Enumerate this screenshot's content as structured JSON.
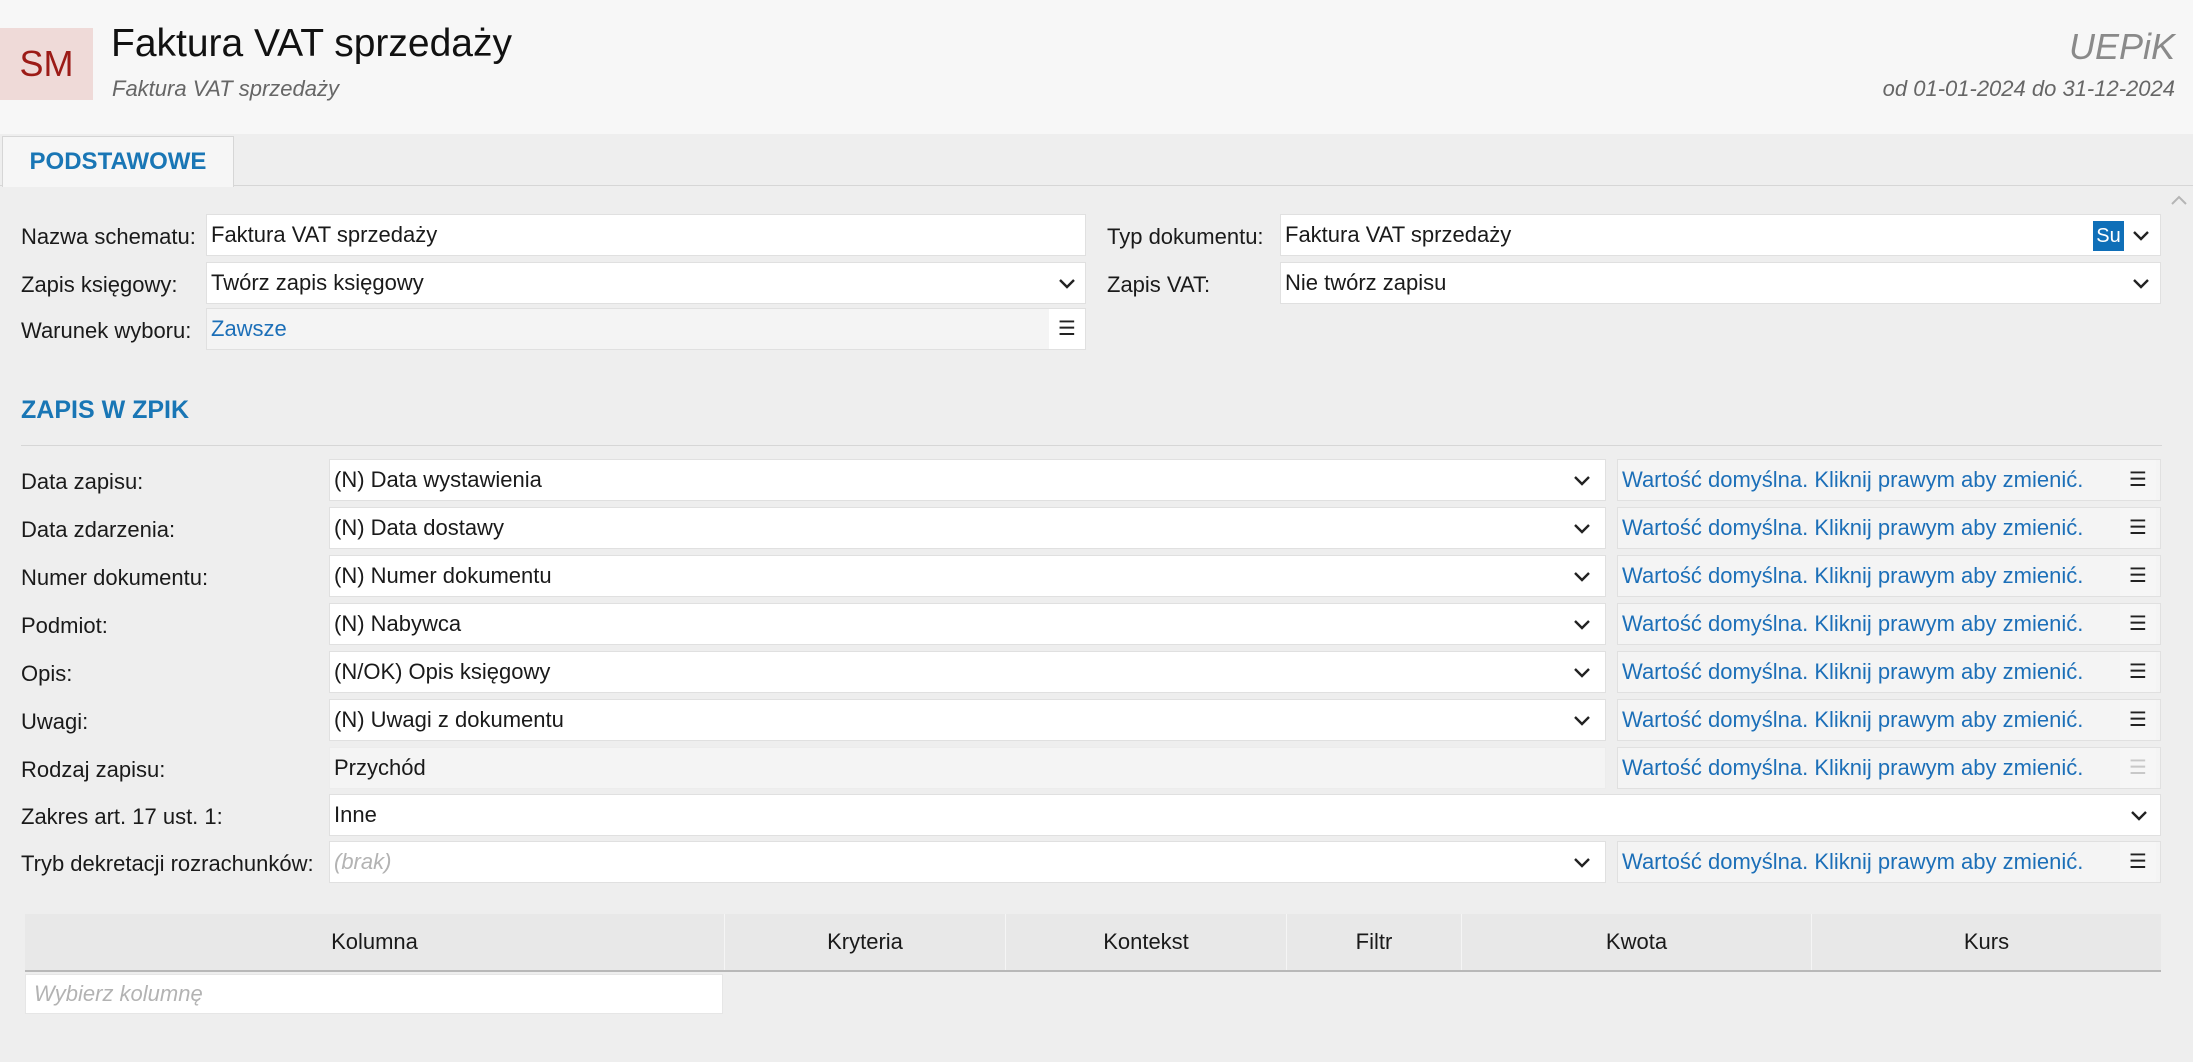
{
  "header": {
    "avatar": "SM",
    "title": "Faktura VAT sprzedaży",
    "subtitle": "Faktura VAT sprzedaży",
    "brand": "UEPiK",
    "period": "od 01-01-2024 do 31-12-2024"
  },
  "tabs": [
    {
      "label": "PODSTAWOWE",
      "active": true
    }
  ],
  "basic": {
    "nazwa_label": "Nazwa schematu:",
    "nazwa_value": "Faktura VAT sprzedaży",
    "typ_label": "Typ dokumentu:",
    "typ_value": "Faktura VAT sprzedaży",
    "typ_button": "Su",
    "zapis_ksieg_label": "Zapis księgowy:",
    "zapis_ksieg_value": "Twórz zapis księgowy",
    "zapis_vat_label": "Zapis VAT:",
    "zapis_vat_value": "Nie twórz zapisu",
    "warunek_label": "Warunek wyboru:",
    "warunek_value": "Zawsze"
  },
  "section": {
    "title": "ZAPIS W ZPIK"
  },
  "rows": [
    {
      "label": "Data zapisu:",
      "value": "(N) Data wystawienia",
      "hint": "Wartość domyślna. Kliknij prawym aby zmienić."
    },
    {
      "label": "Data zdarzenia:",
      "value": "(N) Data dostawy",
      "hint": "Wartość domyślna. Kliknij prawym aby zmienić."
    },
    {
      "label": "Numer dokumentu:",
      "value": "(N) Numer dokumentu",
      "hint": "Wartość domyślna. Kliknij prawym aby zmienić."
    },
    {
      "label": "Podmiot:",
      "value": "(N) Nabywca",
      "hint": "Wartość domyślna. Kliknij prawym aby zmienić."
    },
    {
      "label": "Opis:",
      "value": "(N/OK) Opis księgowy",
      "hint": "Wartość domyślna. Kliknij prawym aby zmienić."
    },
    {
      "label": "Uwagi:",
      "value": "(N) Uwagi z dokumentu",
      "hint": "Wartość domyślna. Kliknij prawym aby zmienić."
    },
    {
      "label": "Rodzaj zapisu:",
      "value": "Przychód",
      "hint": "Wartość domyślna. Kliknij prawym aby zmienić."
    },
    {
      "label": "Zakres art. 17 ust. 1:",
      "value": "Inne"
    },
    {
      "label": "Tryb dekretacji rozrachunków:",
      "value": "(brak)",
      "hint": "Wartość domyślna. Kliknij prawym aby zmienić."
    }
  ],
  "grid": {
    "columns": [
      "Kolumna",
      "Kryteria",
      "Kontekst",
      "Filtr",
      "Kwota",
      "Kurs"
    ],
    "placeholder": "Wybierz kolumnę"
  },
  "colors": {
    "accent": "#1976b5",
    "link": "#1c6fb8",
    "avatar_bg": "#efdad8",
    "avatar_fg": "#9c1b17"
  }
}
